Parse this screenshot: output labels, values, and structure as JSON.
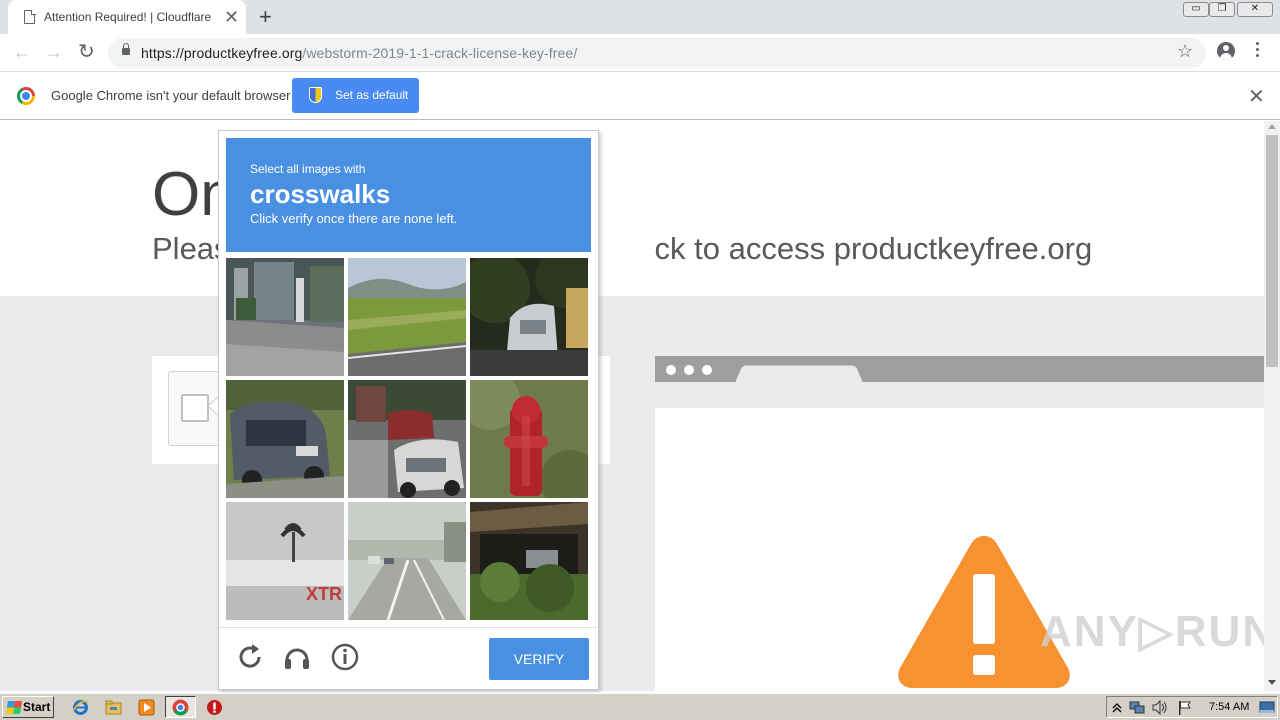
{
  "browser": {
    "tab_title": "Attention Required! | Cloudflare",
    "tab_close": "✕",
    "new_tab": "+",
    "url_host": "https://productkeyfree.org",
    "url_path": "/webstorm-2019-1-1-crack-license-key-free/",
    "back": "←",
    "forward": "→",
    "reload": "↻",
    "bookmark_star": "☆"
  },
  "window_controls": {
    "minimize": "▭",
    "restore": "❐",
    "close": "✕"
  },
  "infobar": {
    "message": "Google Chrome isn't your default browser",
    "button_label": "Set as default",
    "close": "✕"
  },
  "page": {
    "headline_visible_start": "On",
    "subline_left": "Pleas",
    "subline_right": "ck to access productkeyfree.org"
  },
  "captcha": {
    "instruction_line1": "Select all images with",
    "keyword": "crosswalks",
    "instruction_line3": "Click verify once there are none left.",
    "verify_label": "VERIFY"
  },
  "watermark": "ANY▷RUN",
  "taskbar": {
    "start_label": "Start",
    "clock": "7:54 AM"
  },
  "colors": {
    "captcha_blue": "#4a90e2",
    "chrome_button_blue": "#4a8af4",
    "warning_orange": "#f6922f"
  }
}
